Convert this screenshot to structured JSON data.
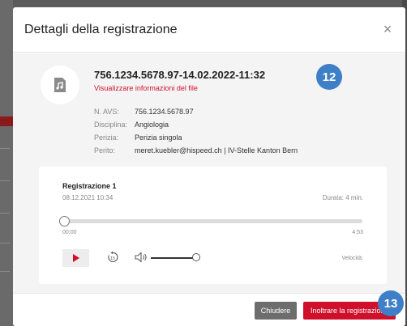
{
  "modal": {
    "title": "Dettagli della registrazione",
    "close_symbol": "×"
  },
  "recording": {
    "title": "756.1234.5678.97-14.02.2022-11:32",
    "file_info_link": "Visualizzare informazioni del file",
    "icon": "audio-file-icon",
    "meta": [
      {
        "key": "N. AVS:",
        "value": "756.1234.5678.97"
      },
      {
        "key": "Disciplina:",
        "value": "Angiologia"
      },
      {
        "key": "Perizia:",
        "value": "Perizia singola"
      },
      {
        "key": "Perito:",
        "value": "meret.kuebler@hispeed.ch | IV-Stelle Kanton Bern"
      }
    ]
  },
  "player": {
    "name": "Registrazione 1",
    "date": "08.12.2021 10:34",
    "duration": "Durata: 4 min.",
    "position_start": "00:00",
    "position_end": "4:53",
    "progress": 0,
    "volume": 1,
    "speed_label": "Velocità:"
  },
  "badges": {
    "first": "12",
    "second": "13"
  },
  "footer": {
    "close_label": "Chiudere",
    "forward_label": "Inoltrare la registrazione"
  },
  "colors": {
    "accent": "#d0102b",
    "badge": "#3f7fc7",
    "secondary_button": "#6d6d6d"
  }
}
